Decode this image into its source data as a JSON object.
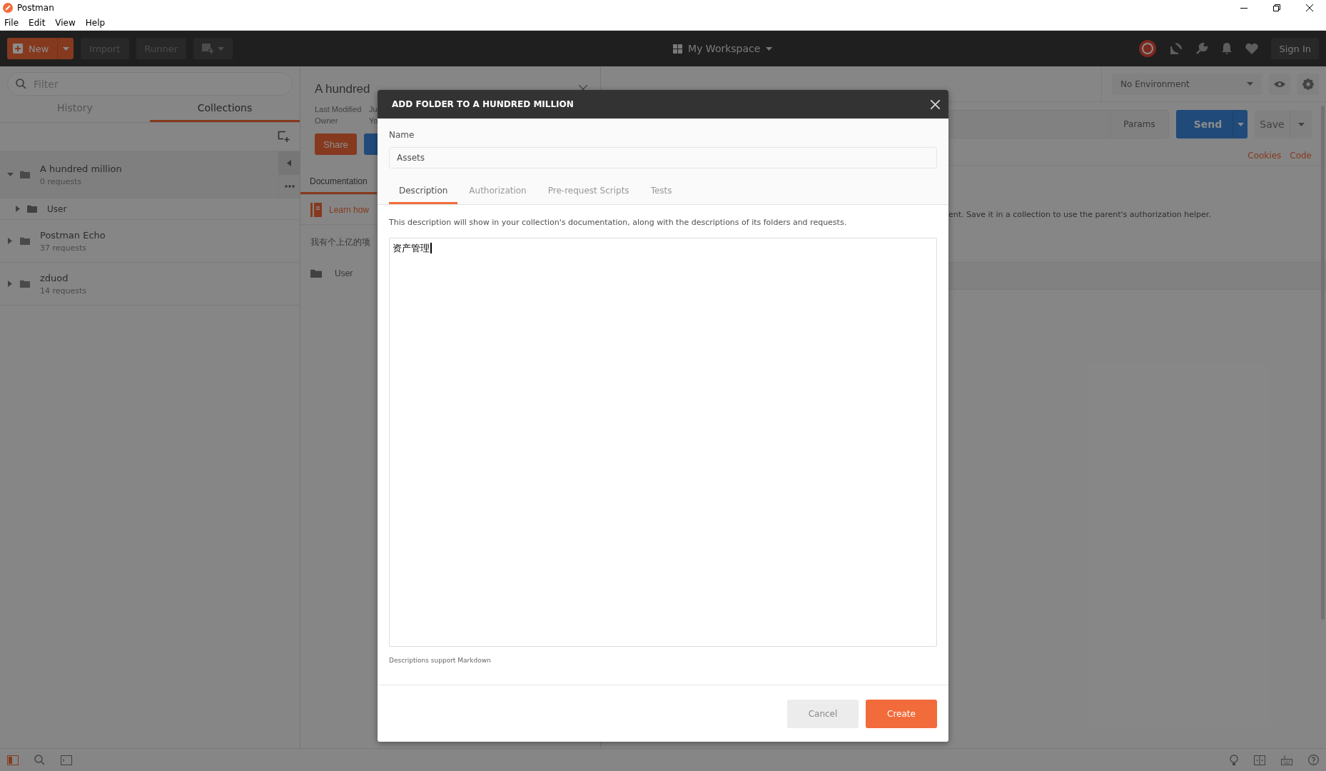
{
  "window": {
    "title": "Postman"
  },
  "menu": [
    "File",
    "Edit",
    "View",
    "Help"
  ],
  "toolbar": {
    "new_label": "New",
    "import_label": "Import",
    "runner_label": "Runner",
    "workspace": "My Workspace",
    "sign_in": "Sign In"
  },
  "sidebar": {
    "filter_placeholder": "Filter",
    "tabs": [
      {
        "label": "History",
        "selected": false
      },
      {
        "label": "Collections",
        "selected": true
      }
    ],
    "collections": [
      {
        "name": "A hundred million",
        "count": "0 requests",
        "expanded": true,
        "selected": true,
        "children": [
          {
            "name": "User"
          }
        ]
      },
      {
        "name": "Postman Echo",
        "count": "37 requests",
        "expanded": false,
        "selected": false
      },
      {
        "name": "zduod",
        "count": "14 requests",
        "expanded": false,
        "selected": false
      }
    ]
  },
  "collection_panel": {
    "title": "A hundred",
    "meta": [
      {
        "label": "Last Modified",
        "value": "Ju"
      },
      {
        "label": "Owner",
        "value": "Yo"
      }
    ],
    "share": "Share",
    "tabs": [
      {
        "label": "Documentation",
        "selected": true
      }
    ],
    "learn_link": "Learn how",
    "description": "我有个上亿的项",
    "folders": [
      {
        "name": "User"
      }
    ]
  },
  "request_panel": {
    "environment": "No Environment",
    "params": "Params",
    "send": "Send",
    "save": "Save",
    "links": [
      "Cookies",
      "Code"
    ],
    "notice": "ent. Save it in a collection to use the parent's authorization helper."
  },
  "dialog": {
    "title": "ADD FOLDER TO A HUNDRED MILLION",
    "name_label": "Name",
    "name_value": "Assets",
    "tabs": [
      {
        "label": "Description",
        "selected": true
      },
      {
        "label": "Authorization",
        "selected": false
      },
      {
        "label": "Pre-request Scripts",
        "selected": false
      },
      {
        "label": "Tests",
        "selected": false
      }
    ],
    "help": "This description will show in your collection's documentation, along with the descriptions of its folders and requests.",
    "description_value": "资产管理",
    "footnote": "Descriptions support Markdown",
    "buttons": [
      {
        "label": "Cancel",
        "kind": "secondary"
      },
      {
        "label": "Create",
        "kind": "primary"
      }
    ]
  }
}
